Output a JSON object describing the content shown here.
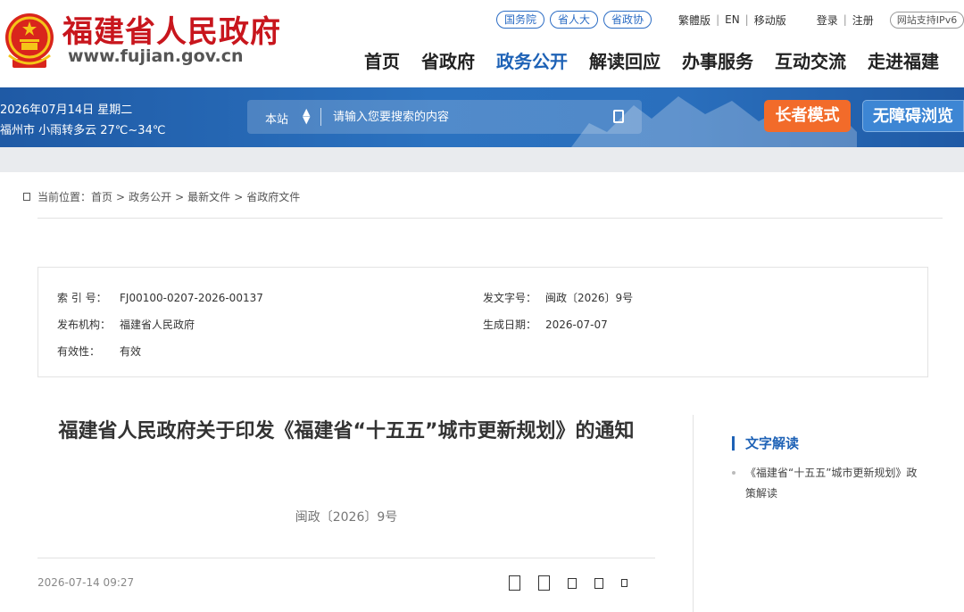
{
  "header": {
    "site_name": "福建省人民政府",
    "site_domain": "www.fujian.gov.cn",
    "emblem_icon": "national-emblem-icon",
    "top_pills": [
      "国务院",
      "省人大",
      "省政协"
    ],
    "utility_links": [
      "繁體版",
      "EN",
      "移动版"
    ],
    "account_links": [
      "登录",
      "注册"
    ],
    "ipv6_badge": "网站支持IPv6",
    "nav": [
      {
        "label": "首页"
      },
      {
        "label": "省政府"
      },
      {
        "label": "政务公开",
        "active": true
      },
      {
        "label": "解读回应"
      },
      {
        "label": "办事服务"
      },
      {
        "label": "互动交流"
      },
      {
        "label": "走进福建"
      }
    ]
  },
  "band": {
    "date": "2026年07月14日 星期二",
    "weather": "福州市 小雨转多云 27℃~34℃",
    "search": {
      "scope": "本站",
      "placeholder": "请输入您要搜索的内容",
      "search_icon": "search-icon"
    },
    "elder_mode": "长者模式",
    "accessible": "无障碍浏览"
  },
  "breadcrumb": {
    "prefix": "当前位置：",
    "items": [
      "首页",
      "政务公开",
      "最新文件",
      "省政府文件"
    ],
    "separator": ">"
  },
  "meta": {
    "index_no_label": "索 引 号：",
    "index_no": "FJ00100-0207-2026-00137",
    "doc_no_label": "发文字号：",
    "doc_no": "闽政〔2026〕9号",
    "issuer_label": "发布机构：",
    "issuer": "福建省人民政府",
    "date_label": "生成日期：",
    "date": "2026-07-07",
    "validity_label": "有效性：",
    "validity": "有效"
  },
  "article": {
    "title": "福建省人民政府关于印发《福建省“十五五”城市更新规划》的通知",
    "doc_no": "闽政〔2026〕9号",
    "published": "2026-07-14 09:27",
    "tools": [
      "font-large-icon",
      "font-medium-icon",
      "font-small-icon",
      "share-icon",
      "print-icon"
    ]
  },
  "sidebar": {
    "heading": "文字解读",
    "items": [
      "《福建省“十五五”城市更新规划》政策解读"
    ]
  },
  "colors": {
    "brand_red": "#c8161d",
    "brand_blue": "#1e62b6",
    "band_blue": "#2b72c0",
    "elder_orange": "#f26b2a"
  }
}
